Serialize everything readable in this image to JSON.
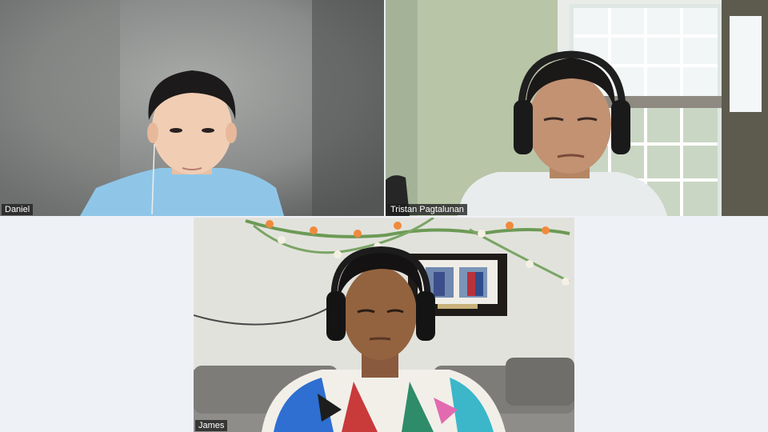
{
  "meeting": {
    "background_color": "#eef1f6",
    "active_speaker_border": "#2d8cff",
    "participants": [
      {
        "name": "Daniel",
        "active_speaker": true
      },
      {
        "name": "Tristan Pagtalunan",
        "active_speaker": false
      },
      {
        "name": "James",
        "active_speaker": false
      }
    ]
  }
}
